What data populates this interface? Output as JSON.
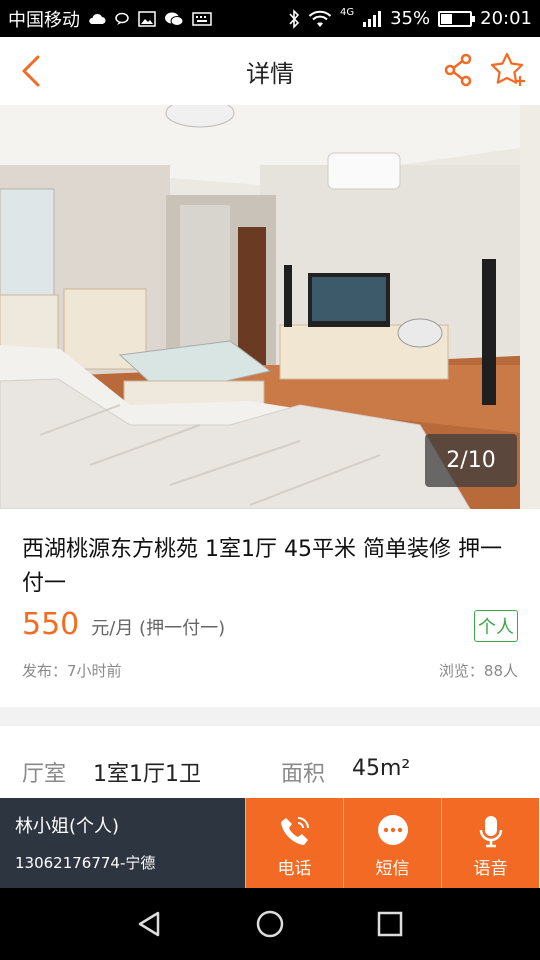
{
  "status_bar": {
    "carrier": "中国移动",
    "network_type": "4G",
    "battery": "35%",
    "time": "20:01"
  },
  "nav": {
    "title": "详情"
  },
  "photo": {
    "counter": "2/10"
  },
  "listing": {
    "title": "西湖桃源东方桃苑 1室1厅 45平米 简单装修 押一付一",
    "price": "550",
    "price_unit": "元/月 (押一付一)",
    "owner_badge": "个人",
    "published": "发布：7小时前",
    "views": "浏览：88人"
  },
  "details": {
    "layout_label": "厅室",
    "layout_value": "1室1厅1卫",
    "area_label": "面积",
    "area_value": "45m²"
  },
  "contact": {
    "name": "林小姐(个人)",
    "phone": "13062176774-宁德"
  },
  "actions": {
    "call": "电话",
    "sms": "短信",
    "voice": "语音"
  },
  "colors": {
    "accent": "#f26a23",
    "badge_green": "#3aa84b",
    "contact_bg": "#2d3640"
  }
}
